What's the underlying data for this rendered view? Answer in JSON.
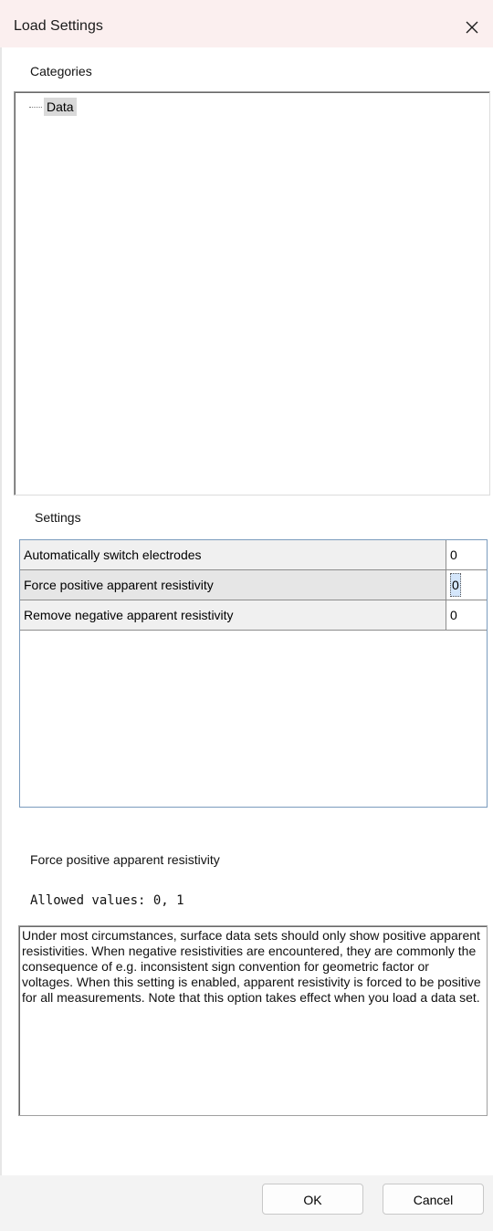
{
  "window": {
    "title": "Load Settings",
    "close_icon": "close-icon"
  },
  "categories": {
    "label": "Categories",
    "items": [
      {
        "label": "Data",
        "selected": true
      }
    ]
  },
  "settings": {
    "label": "Settings",
    "rows": [
      {
        "name": "Automatically switch electrodes",
        "value": "0",
        "selected": false
      },
      {
        "name": "Force positive apparent resistivity",
        "value": "0",
        "selected": true
      },
      {
        "name": "Remove negative apparent resistivity",
        "value": "0",
        "selected": false
      }
    ]
  },
  "detail": {
    "title": "Force positive apparent resistivity",
    "allowed_values": "Allowed values: 0, 1",
    "description": "Under most circumstances, surface data sets should only show positive apparent resistivities. When negative resistivities are encountered, they are commonly the consequence of e.g. inconsistent sign convention for geometric factor or voltages. When this setting is enabled, apparent resistivity is forced to be positive for all measurements. Note that this option takes effect when you load a data set."
  },
  "buttons": {
    "ok": "OK",
    "cancel": "Cancel"
  },
  "colors": {
    "titlebar": "#fbefef",
    "grid_border": "#7a9bbd",
    "selection_focus": "#d4e6fb"
  }
}
